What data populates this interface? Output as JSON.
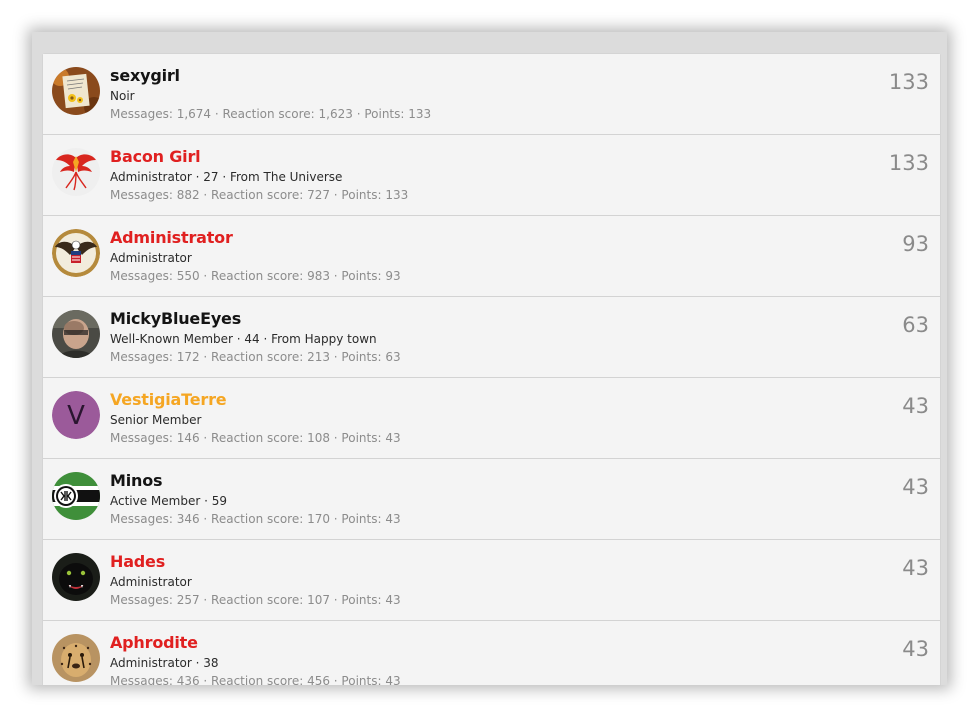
{
  "members": [
    {
      "name": "sexygirl",
      "role_line": "Noir",
      "stats_line": "Messages: 1,674 · Reaction score: 1,623 · Points: 133",
      "score": "133",
      "style": "normal",
      "avatar_icon": "note-photo-avatar"
    },
    {
      "name": "Bacon Girl",
      "role_line": "Administrator · 27 · From The Universe",
      "stats_line": "Messages: 882 · Reaction score: 727 · Points: 133",
      "score": "133",
      "style": "staff",
      "avatar_icon": "phoenix-avatar"
    },
    {
      "name": "Administrator",
      "role_line": "Administrator",
      "stats_line": "Messages: 550 · Reaction score: 983 · Points: 93",
      "score": "93",
      "style": "staff",
      "avatar_icon": "eagle-seal-avatar"
    },
    {
      "name": "MickyBlueEyes",
      "role_line": "Well-Known Member · 44 · From Happy town",
      "stats_line": "Messages: 172 · Reaction score: 213 · Points: 63",
      "score": "63",
      "style": "normal",
      "avatar_icon": "photo-avatar"
    },
    {
      "name": "VestigiaTerre",
      "role_line": "Senior Member",
      "stats_line": "Messages: 146 · Reaction score: 108 · Points: 43",
      "score": "43",
      "style": "senior",
      "avatar_icon": "letter-avatar",
      "avatar_letter": "V",
      "avatar_color": "#9b5a9a"
    },
    {
      "name": "Minos",
      "role_line": "Active Member · 59",
      "stats_line": "Messages: 346 · Reaction score: 170 · Points: 43",
      "score": "43",
      "style": "normal",
      "avatar_icon": "flag-avatar"
    },
    {
      "name": "Hades",
      "role_line": "Administrator",
      "stats_line": "Messages: 257 · Reaction score: 107 · Points: 43",
      "score": "43",
      "style": "staff",
      "avatar_icon": "panther-avatar"
    },
    {
      "name": "Aphrodite",
      "role_line": "Administrator · 38",
      "stats_line": "Messages: 436 · Reaction score: 456 · Points: 43",
      "score": "43",
      "style": "staff",
      "avatar_icon": "cheetah-avatar"
    }
  ]
}
